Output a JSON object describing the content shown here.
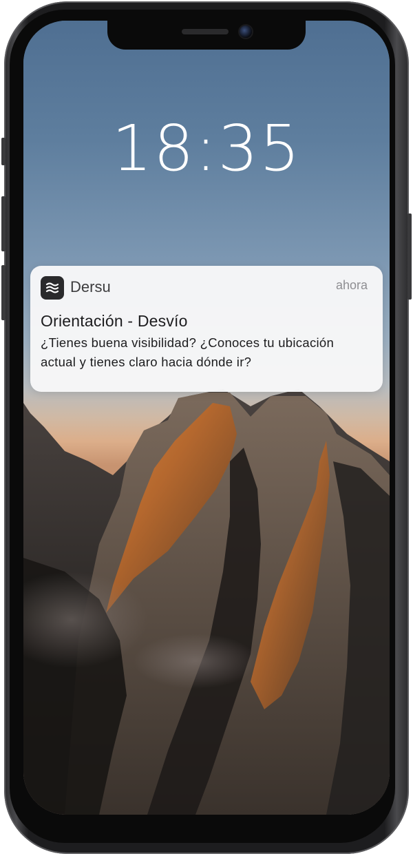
{
  "lock_screen": {
    "time": "18:35"
  },
  "notification": {
    "app_name": "Dersu",
    "app_icon": "waves-icon",
    "timestamp": "ahora",
    "title": "Orientación - Desvío",
    "body": "¿Tienes buena visibilidad? ¿Conoces tu ubicación actual y tienes claro hacia dónde ir?"
  },
  "colors": {
    "notification_bg": "#f7f7f8",
    "app_icon_bg": "#2a2a2c",
    "clock_text": "#ffffff",
    "frame": "#1d1d1f"
  }
}
